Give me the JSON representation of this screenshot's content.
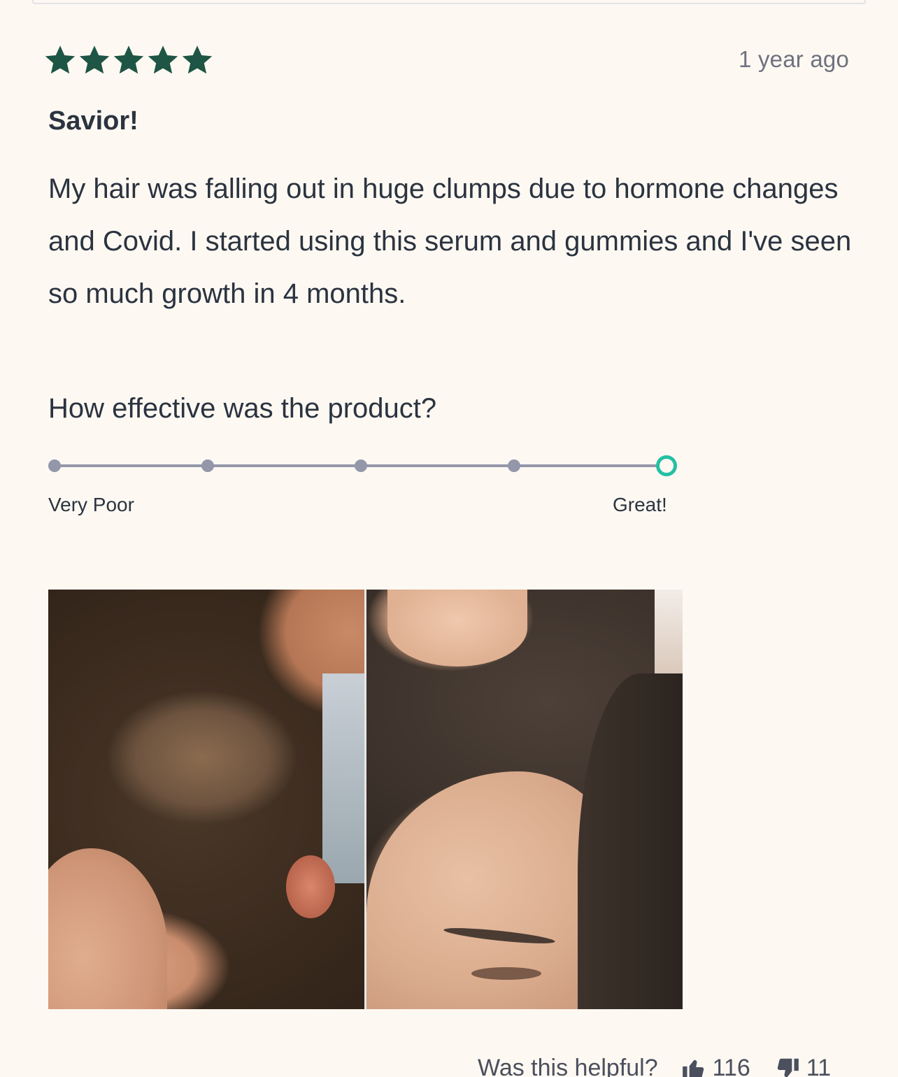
{
  "review": {
    "rating": 5,
    "rating_max": 5,
    "star_color": "#1e5544",
    "date": "1 year ago",
    "title": "Savior!",
    "body": "My hair was falling out in huge clumps due to hormone changes and Covid. I started using this serum and gummies and I've seen so much growth in 4 months."
  },
  "effectiveness": {
    "question": "How effective was the product?",
    "steps": 5,
    "selected_step": 5,
    "low_label": "Very Poor",
    "high_label": "Great!",
    "accent_color": "#24c0a4"
  },
  "photo": {
    "description_icon": "before-after-photo"
  },
  "helpful": {
    "question": "Was this helpful?",
    "up_count": "116",
    "down_count": "11"
  }
}
